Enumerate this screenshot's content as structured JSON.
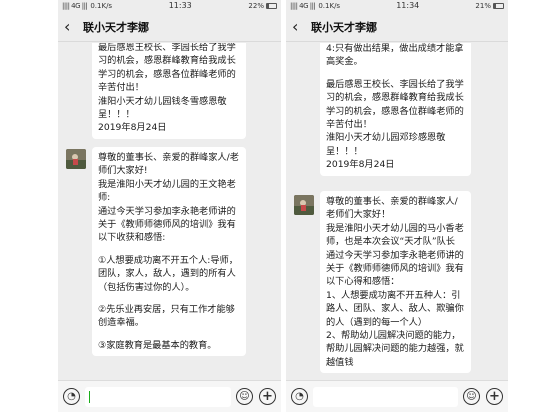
{
  "status_left": {
    "signal": "|||| 4G |||",
    "speed": "0.1K/s",
    "time": "11:33",
    "battery": "22%",
    "battery_level": 0.22
  },
  "status_right": {
    "signal": "|||| 4G |||",
    "speed": "0.1K/s",
    "time": "11:34",
    "battery": "21%",
    "battery_level": 0.21
  },
  "chat_left": {
    "title": "联小天才李娜",
    "messages": [
      {
        "lines": [
          "最后感恩王校长、李园长给了我学习的机会，感恩群峰教育给我成长学习的机会，感恩各位群峰老师的辛苦付出！",
          "淮阳小天才幼儿园钱冬雪感恩敬呈！！！",
          "2019年8月24日"
        ]
      },
      {
        "lines": [
          "尊敬的董事长、亲爱的群峰家人/老师们大家好!",
          "我是淮阳小天才幼儿园的王文艳老师:",
          "通过今天学习参加李永艳老师讲的关于《教师师德师风的培训》我有以下收获和感悟:",
          "",
          "①人想要成功离不开五个人:导师，团队，家人，敌人，遇到的所有人（包括伤害过你的人）。",
          "",
          "②先乐业再安居，只有工作才能够创造幸福。",
          "",
          "③家庭教育是最基本的教育。"
        ]
      }
    ]
  },
  "chat_right": {
    "title": "联小天才李娜",
    "messages": [
      {
        "lines": [
          "4:只有做出结果，做出成绩才能拿高奖金。",
          "",
          "最后感恩王校长、李园长给了我学习的机会，感恩群峰教育给我成长学习的机会，感恩各位群峰老师的辛苦付出！",
          "淮阳小天才幼儿园邓珍感恩敬呈！！！",
          "2019年8月24日"
        ]
      },
      {
        "lines": [
          "尊敬的董事长、亲爱的群峰家人/老师们大家好！",
          "我是淮阳小天才幼儿园的马小香老师，也是本次会议“天才队”队长",
          "通过今天学习参加李永艳老师讲的关于《教师师德师风的培训》我有以下心得和感悟：",
          "1、人想要成功离不开五种人：引路人、团队、家人、敌人、欺骗你的人（遇到的每一个人）",
          "2、帮助幼儿园解决问题的能力，帮助儿园解决问题的能力越强，就越值钱"
        ]
      }
    ]
  },
  "icons": {
    "back": "chevron-left-icon",
    "voice": "voice-icon",
    "emoji": "emoji-icon",
    "add": "plus-icon"
  },
  "colors": {
    "chat_background": "#ededed",
    "bubble": "#ffffff",
    "caret": "#1aad19"
  }
}
